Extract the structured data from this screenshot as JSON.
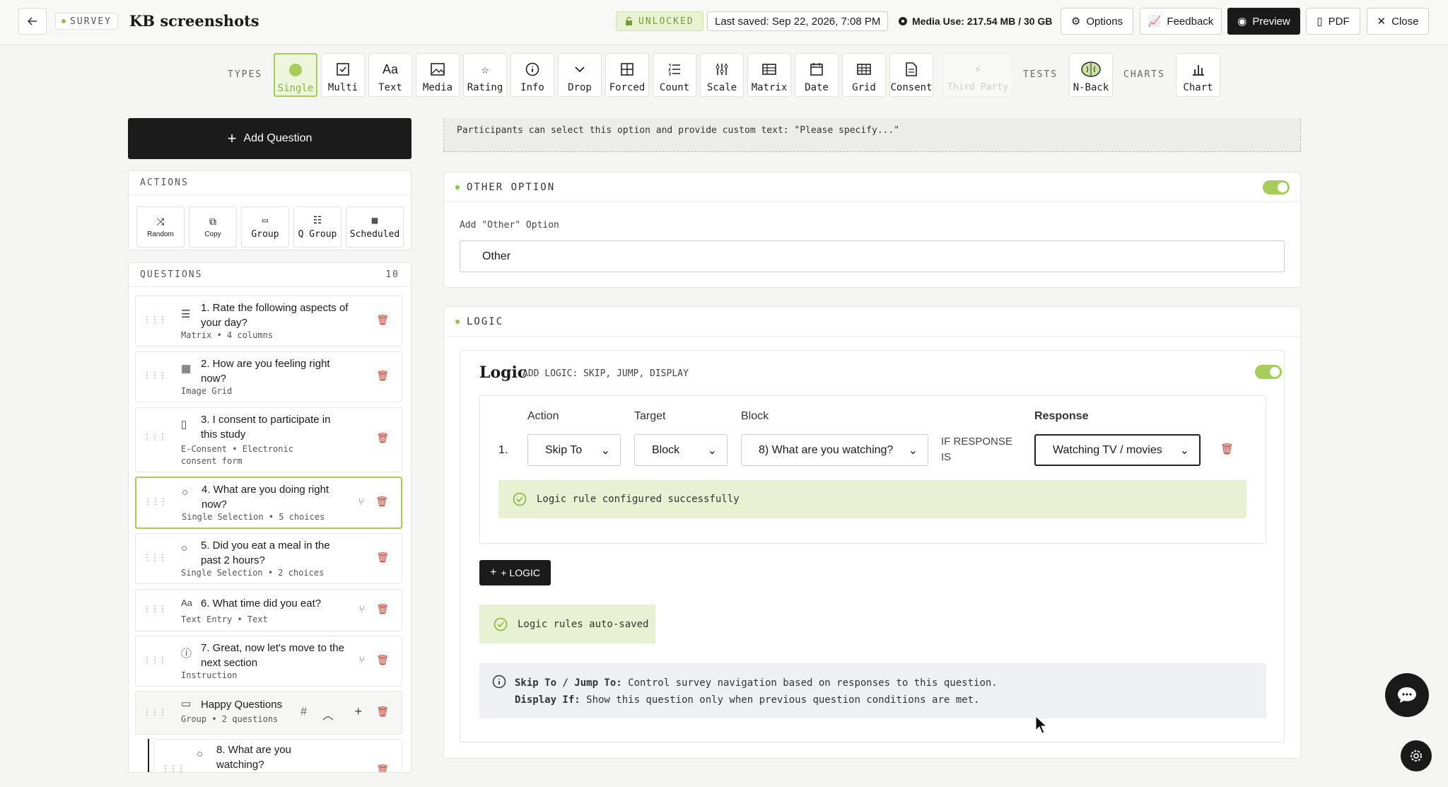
{
  "header": {
    "back_label": "←",
    "survey_tag": "SURVEY",
    "title": "KB screenshots",
    "unlocked": "UNLOCKED",
    "last_saved": "Last saved: Sep 22, 2026, 7:08 PM",
    "media_use": "Media Use: 217.54 MB / 30 GB",
    "options": "Options",
    "feedback": "Feedback",
    "preview": "Preview",
    "pdf": "PDF",
    "close": "Close"
  },
  "toolbar": {
    "types_label": "TYPES",
    "tests_label": "TESTS",
    "charts_label": "CHARTS",
    "types": [
      "Single",
      "Multi",
      "Text",
      "Media",
      "Rating",
      "Info",
      "Drop",
      "Forced",
      "Count",
      "Scale",
      "Matrix",
      "Date",
      "Grid",
      "Consent",
      "Third Party"
    ],
    "tests": [
      "N-Back"
    ],
    "charts": [
      "Chart"
    ]
  },
  "left": {
    "add_question": "Add Question",
    "actions_label": "ACTIONS",
    "actions": [
      "Random",
      "Copy",
      "Group",
      "Q Group",
      "Scheduled"
    ],
    "questions_label": "QUESTIONS",
    "questions_count": "10",
    "questions": [
      {
        "title": "1. Rate the following aspects of your day?",
        "sub": "Matrix • 4 columns"
      },
      {
        "title": "2. How are you feeling right now?",
        "sub": "Image Grid"
      },
      {
        "title": "3. I consent to participate in this study",
        "sub": "E-Consent • Electronic consent form"
      },
      {
        "title": "4. What are you doing right now?",
        "sub": "Single Selection • 5 choices"
      },
      {
        "title": "5. Did you eat a meal in the past 2 hours?",
        "sub": "Single Selection • 2 choices"
      },
      {
        "title": "6. What time did you eat?",
        "sub": "Text Entry • Text"
      },
      {
        "title": "7. Great, now let's move to the next section",
        "sub": "Instruction"
      },
      {
        "title": "Happy Questions",
        "sub": "Group • 2 questions"
      },
      {
        "title": "8. What are you watching?",
        "sub": ""
      }
    ]
  },
  "right": {
    "info_text": "Participants can select this option and provide custom text: \"Please specify...\"",
    "other_section": "OTHER OPTION",
    "other_label": "Add \"Other\" Option",
    "other_value": "Other",
    "logic_section": "LOGIC",
    "logic_title": "Logic",
    "logic_subtitle": "ADD LOGIC: SKIP, JUMP, DISPLAY",
    "col_action": "Action",
    "col_target": "Target",
    "col_block": "Block",
    "col_response": "Response",
    "rule_number": "1.",
    "action_value": "Skip To",
    "target_value": "Block",
    "block_value": "8) What are you watching?",
    "if_response": "IF RESPONSE IS",
    "response_value": "Watching TV / movies",
    "success_msg": "Logic rule configured successfully",
    "add_logic": "+ LOGIC",
    "autosaved": "Logic rules auto-saved",
    "help_line1_bold": "Skip To / Jump To:",
    "help_line1": " Control survey navigation based on responses to this question.",
    "help_line2_bold": "Display If:",
    "help_line2": " Show this question only when previous question conditions are met."
  },
  "colors": {
    "accent": "#a6cd5a",
    "danger": "#c0392b",
    "dark": "#1b1b1b"
  }
}
